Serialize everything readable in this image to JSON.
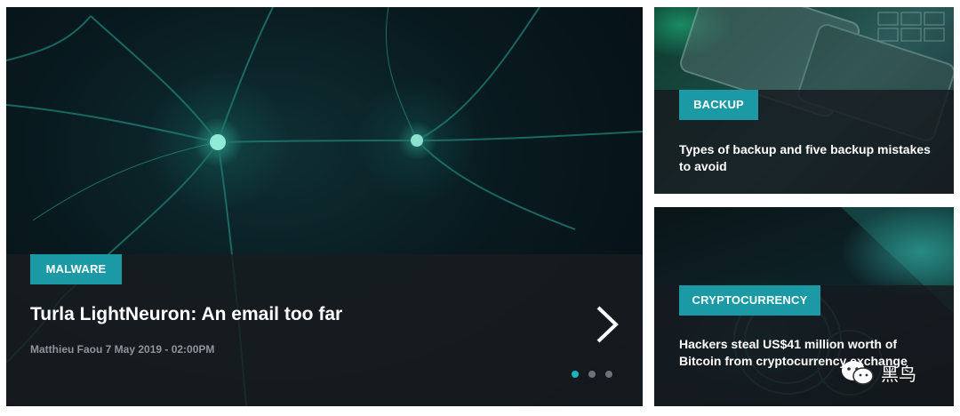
{
  "featured": {
    "category": "MALWARE",
    "title": "Turla LightNeuron: An email too far",
    "meta": "Matthieu Faou 7 May 2019 - 02:00PM",
    "next_icon": "chevron-right-icon",
    "slides": {
      "count": 3,
      "active": 1
    }
  },
  "side_articles": [
    {
      "category": "BACKUP",
      "title": "Types of backup and five backup mistakes to avoid"
    },
    {
      "category": "CRYPTOCURRENCY",
      "title": "Hackers steal US$41 million worth of Bitcoin from cryptocurrency exchange"
    }
  ],
  "watermark": {
    "icon": "wechat-icon",
    "text": "黑鸟"
  },
  "colors": {
    "accent": "#1b9aa6",
    "dot_active": "#1bb3c2",
    "meta_text": "#8e959b"
  }
}
